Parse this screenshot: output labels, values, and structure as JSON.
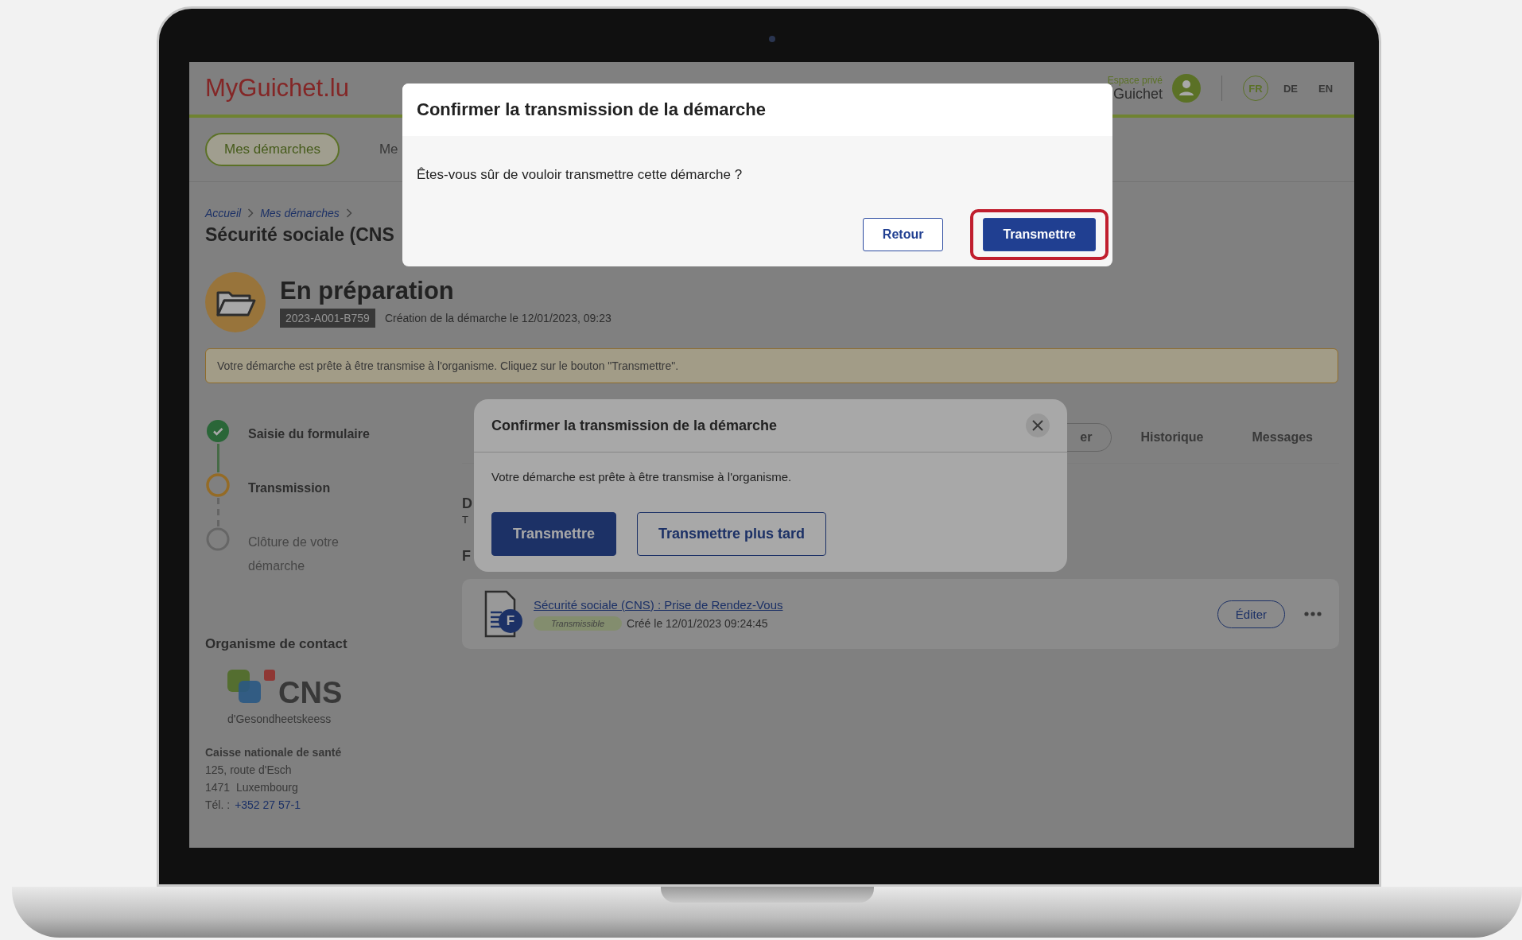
{
  "header": {
    "logo": "MyGuichet.lu",
    "account_caption": "Espace privé",
    "account_name": "Guichet",
    "languages": [
      {
        "label": "FR",
        "selected": true
      },
      {
        "label": "DE",
        "selected": false
      },
      {
        "label": "EN",
        "selected": false
      }
    ]
  },
  "nav": [
    {
      "label": "Mes démarches",
      "selected": true
    },
    {
      "label": "Me",
      "selected": false
    }
  ],
  "breadcrumb": [
    "Accueil",
    "Mes démarches"
  ],
  "page_title": "Sécurité sociale (CNS",
  "status": {
    "title": "En préparation",
    "reference": "2023-A001-B759",
    "created": "Création de la démarche le 12/01/2023, 09:23"
  },
  "alert": "Votre démarche est prête à être transmise à l'organisme. Cliquez sur le bouton \"Transmettre\".",
  "steps": [
    {
      "label": "Saisie du formulaire",
      "kind": "done"
    },
    {
      "label": "Transmission",
      "kind": "current"
    },
    {
      "label": "Clôture de votre démarche",
      "kind": "pending"
    }
  ],
  "contact": {
    "heading": "Organisme de contact",
    "logo_name": "CNS",
    "logo_tagline": "d'Gesondheetskeess",
    "name": "Caisse nationale de santé",
    "address": [
      "125, route d'Esch",
      "1471  Luxembourg"
    ],
    "phone_label": "Tél. :",
    "phone": "+352 27 57-1"
  },
  "tabs": [
    {
      "label": "er",
      "selected": true
    },
    {
      "label": "Historique",
      "selected": false
    },
    {
      "label": "Messages",
      "selected": false
    }
  ],
  "section_fragments": [
    "D",
    "T",
    "F"
  ],
  "file": {
    "title": "Sécurité sociale (CNS) : Prise de Rendez-Vous",
    "icon_letter": "F",
    "tag": "Transmissible",
    "created": "Créé le 12/01/2023 09:24:45",
    "edit_button": "Éditer"
  },
  "background_dialog": {
    "title": "Confirmer la transmission de la démarche",
    "message": "Votre démarche est prête à être transmise à l'organisme.",
    "buttons": [
      {
        "label": "Transmettre",
        "kind": "primary"
      },
      {
        "label": "Transmettre plus tard",
        "kind": "secondary"
      }
    ]
  },
  "dialog": {
    "title": "Confirmer la transmission de la démarche",
    "message": "Êtes-vous sûr de vouloir transmettre cette démarche ?",
    "buttons": [
      {
        "label": "Retour",
        "kind": "secondary",
        "highlighted": false
      },
      {
        "label": "Transmettre",
        "kind": "primary",
        "highlighted": true
      }
    ]
  }
}
